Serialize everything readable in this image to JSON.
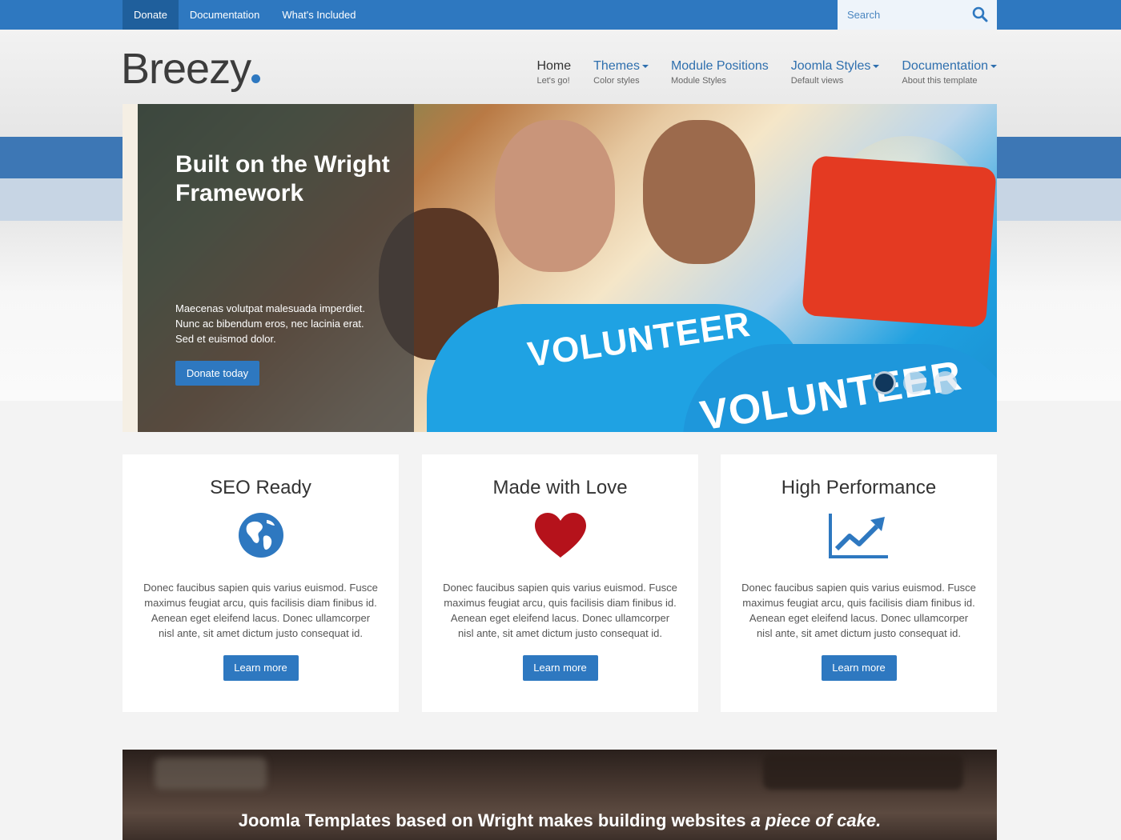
{
  "topbar": {
    "links": [
      "Donate",
      "Documentation",
      "What's Included"
    ],
    "search_placeholder": "Search"
  },
  "header": {
    "logo": "Breezy",
    "nav": [
      {
        "label": "Home",
        "sub": "Let's go!"
      },
      {
        "label": "Themes",
        "sub": "Color styles"
      },
      {
        "label": "Module Positions",
        "sub": "Module Styles"
      },
      {
        "label": "Joomla Styles",
        "sub": "Default views"
      },
      {
        "label": "Documentation",
        "sub": "About this template"
      }
    ]
  },
  "hero": {
    "title": "Built on the Wright Framework",
    "text": "Maecenas volutpat malesuada imperdiet. Nunc ac bibendum eros, nec lacinia erat. Sed et euismod dolor.",
    "cta": "Donate today",
    "shirt_text": "VOLUNTEER",
    "slides": 3,
    "active_slide": 1
  },
  "features": [
    {
      "title": "SEO Ready",
      "icon": "globe-icon",
      "text": "Donec faucibus sapien quis varius euismod. Fusce maximus feugiat arcu, quis facilisis diam finibus id. Aenean eget eleifend lacus. Donec ullamcorper nisl ante, sit amet dictum justo consequat id.",
      "button": "Learn more"
    },
    {
      "title": "Made with Love",
      "icon": "heart-icon",
      "text": "Donec faucibus sapien quis varius euismod. Fusce maximus feugiat arcu, quis facilisis diam finibus id. Aenean eget eleifend lacus. Donec ullamcorper nisl ante, sit amet dictum justo consequat id.",
      "button": "Learn more"
    },
    {
      "title": "High Performance",
      "icon": "line-chart-icon",
      "text": "Donec faucibus sapien quis varius euismod. Fusce maximus feugiat arcu, quis facilisis diam finibus id. Aenean eget eleifend lacus. Donec ullamcorper nisl ante, sit amet dictum justo consequat id.",
      "button": "Learn more"
    }
  ],
  "banner": {
    "text": "Joomla Templates based on Wright makes building websites",
    "emphasis": "a piece of cake."
  },
  "colors": {
    "primary": "#2e78c0",
    "primary_dark": "#1f5f9c",
    "heart": "#b5121b"
  }
}
